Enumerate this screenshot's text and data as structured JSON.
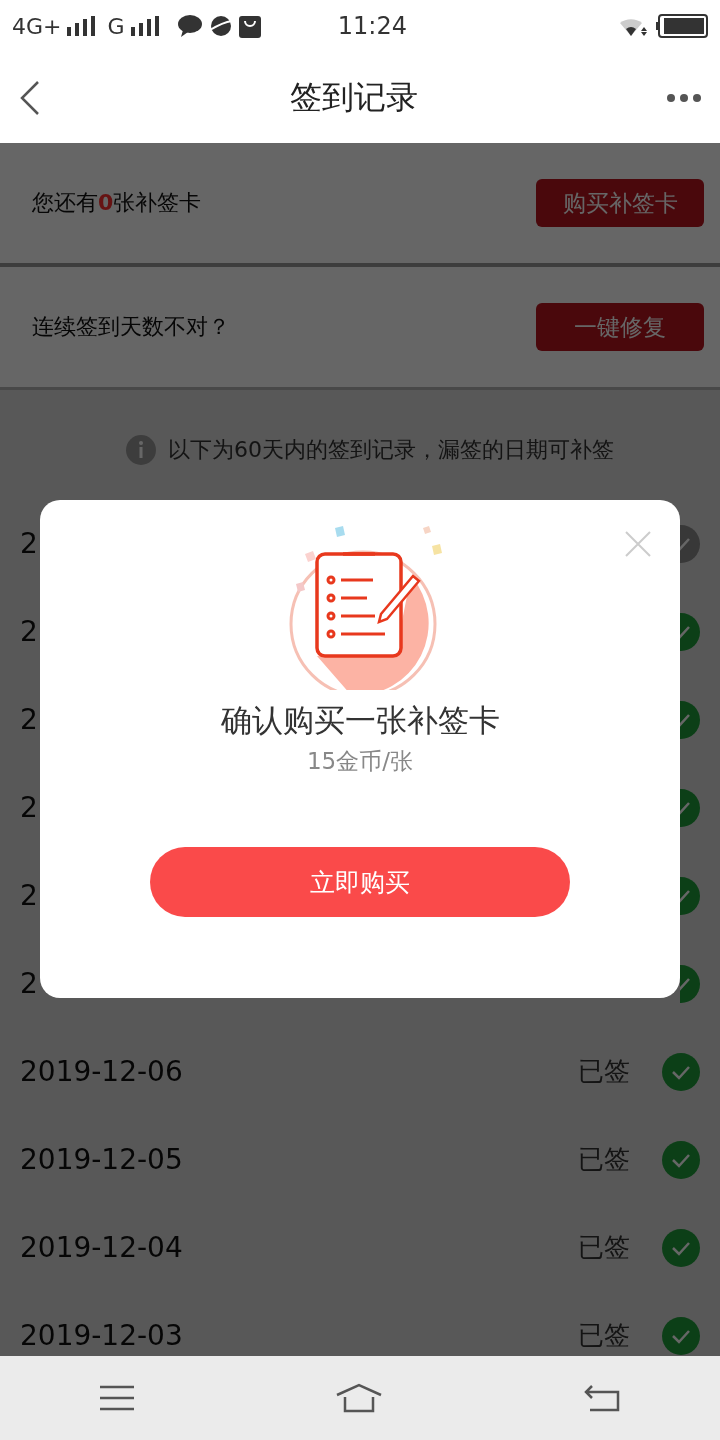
{
  "status_bar": {
    "network": "4G+",
    "network_2": "G",
    "time": "11:24"
  },
  "header": {
    "title": "签到记录"
  },
  "cards": [
    {
      "kind": "balance",
      "prefix": "您还有",
      "count": "0",
      "suffix": "张补签卡",
      "button": "购买补签卡"
    },
    {
      "kind": "repair",
      "text": "连续签到天数不对？",
      "button": "一键修复"
    }
  ],
  "notice": "以下为60天内的签到记录，漏签的日期可补签",
  "records": [
    {
      "date": "2",
      "signed": false
    },
    {
      "date": "2",
      "signed": true
    },
    {
      "date": "2",
      "signed": true
    },
    {
      "date": "2",
      "signed": true
    },
    {
      "date": "2",
      "signed": true
    },
    {
      "date": "2",
      "signed": true
    },
    {
      "date": "2019-12-06",
      "status": "已签",
      "signed": true
    },
    {
      "date": "2019-12-05",
      "status": "已签",
      "signed": true
    },
    {
      "date": "2019-12-04",
      "status": "已签",
      "signed": true
    },
    {
      "date": "2019-12-03",
      "status": "已签",
      "signed": true
    }
  ],
  "dialog": {
    "title": "确认购买一张补签卡",
    "price": "15金币/张",
    "button": "立即购买"
  }
}
